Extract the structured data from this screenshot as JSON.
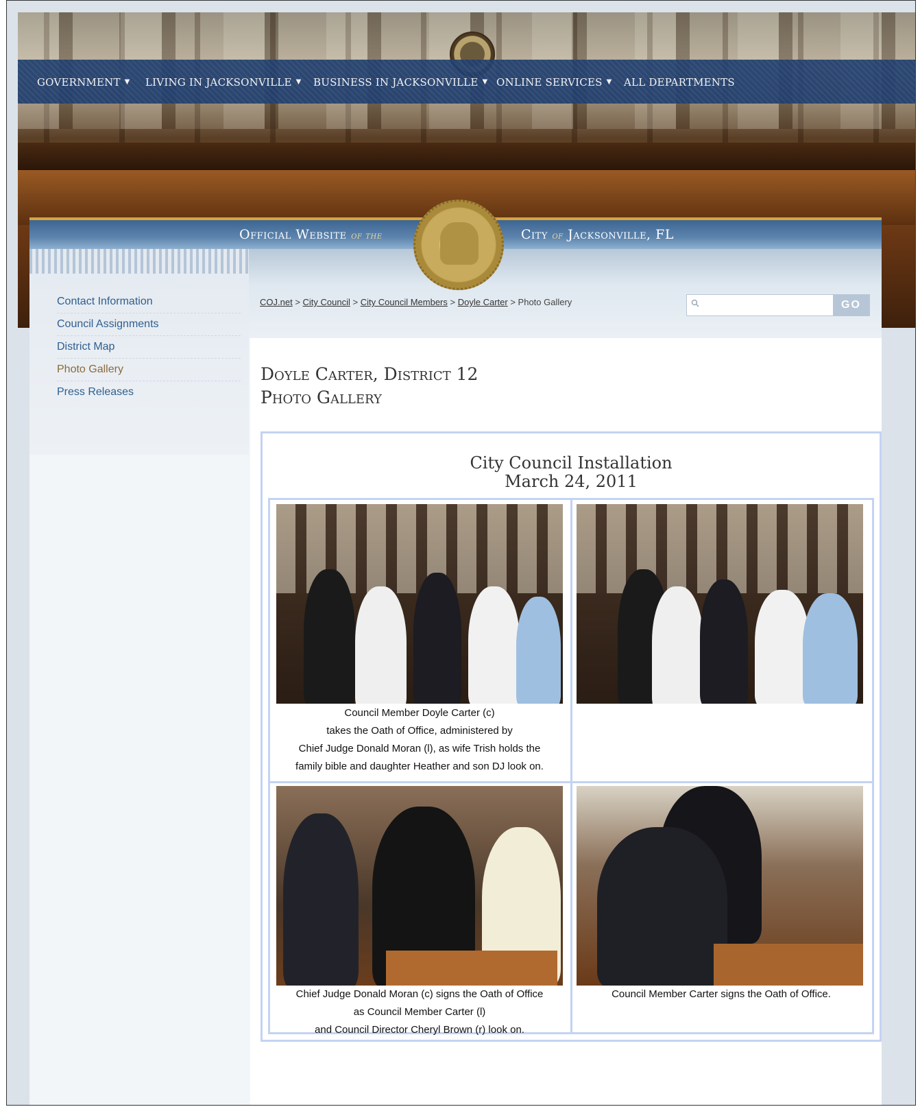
{
  "nav": [
    {
      "label": "GOVERNMENT",
      "caret": "▼"
    },
    {
      "label": "LIVING IN JACKSONVILLE",
      "caret": "▼"
    },
    {
      "label": "BUSINESS IN JACKSONVILLE",
      "caret": "▼"
    },
    {
      "label": "ONLINE SERVICES",
      "caret": "▼"
    },
    {
      "label": "ALL DEPARTMENTS",
      "caret": ""
    }
  ],
  "banner": {
    "left_main": "Official Website",
    "left_italic": "of the",
    "right_city": "City",
    "right_italic": "of",
    "right_main": "Jacksonville, FL"
  },
  "sidebar": {
    "items": [
      {
        "label": "Contact Information",
        "active": false
      },
      {
        "label": "Council Assignments",
        "active": false
      },
      {
        "label": "District Map",
        "active": false
      },
      {
        "label": "Photo Gallery",
        "active": true
      },
      {
        "label": "Press Releases",
        "active": false
      }
    ]
  },
  "breadcrumb": {
    "links": [
      "COJ.net",
      "City Council",
      "City Council Members",
      "Doyle Carter"
    ],
    "separator": ">",
    "current": "Photo Gallery"
  },
  "search": {
    "placeholder": "",
    "value": "",
    "button": "GO"
  },
  "page": {
    "title_line1": "Doyle Carter, District 12",
    "title_line2": "Photo Gallery"
  },
  "gallery": {
    "title": "City Council Installation",
    "date": "March 24, 2011",
    "captions": [
      [
        "Council Member Doyle Carter (c)",
        "takes the Oath of Office, administered by",
        "Chief Judge Donald Moran (l), as wife Trish holds the",
        "family bible and daughter Heather and son DJ look on."
      ],
      [],
      [
        "Chief Judge Donald Moran (c) signs the Oath of Office",
        "as Council Member Carter (l)",
        "and Council Director Cheryl Brown (r) look on."
      ],
      [
        "Council Member Carter signs the Oath of Office."
      ]
    ]
  }
}
